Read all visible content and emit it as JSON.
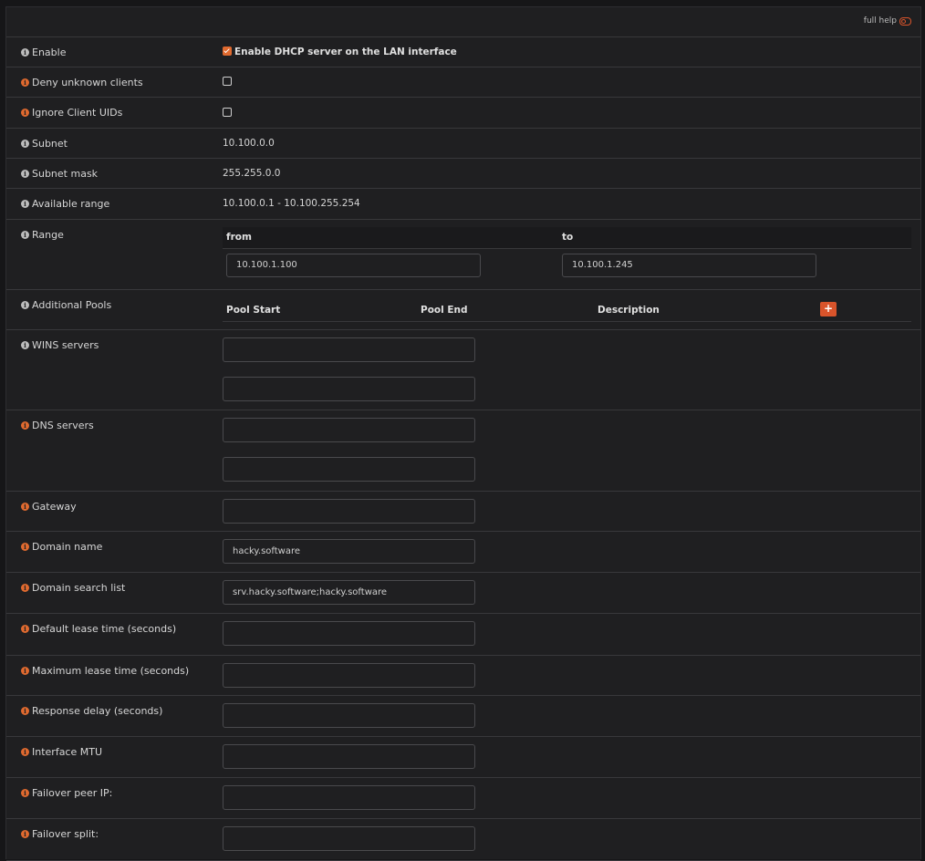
{
  "header": {
    "full_help": "full help"
  },
  "rows": {
    "enable": {
      "label": "Enable",
      "checkbox_label": "Enable DHCP server on the LAN interface",
      "checked": true
    },
    "deny_unknown": {
      "label": "Deny unknown clients",
      "checked": false
    },
    "ignore_uids": {
      "label": "Ignore Client UIDs",
      "checked": false
    },
    "subnet": {
      "label": "Subnet",
      "value": "10.100.0.0"
    },
    "subnet_mask": {
      "label": "Subnet mask",
      "value": "255.255.0.0"
    },
    "available_range": {
      "label": "Available range",
      "value": "10.100.0.1 - 10.100.255.254"
    },
    "range": {
      "label": "Range",
      "from_label": "from",
      "to_label": "to",
      "from_value": "10.100.1.100",
      "to_value": "10.100.1.245"
    },
    "pools": {
      "label": "Additional Pools",
      "col_start": "Pool Start",
      "col_end": "Pool End",
      "col_desc": "Description",
      "add": "+"
    },
    "wins": {
      "label": "WINS servers",
      "value1": "",
      "value2": ""
    },
    "dns": {
      "label": "DNS servers",
      "value1": "",
      "value2": ""
    },
    "gateway": {
      "label": "Gateway",
      "value": ""
    },
    "domain_name": {
      "label": "Domain name",
      "value": "hacky.software"
    },
    "domain_search": {
      "label": "Domain search list",
      "value": "srv.hacky.software;hacky.software"
    },
    "default_lease": {
      "label": "Default lease time (seconds)",
      "value": ""
    },
    "max_lease": {
      "label": "Maximum lease time (seconds)",
      "value": ""
    },
    "response_delay": {
      "label": "Response delay (seconds)",
      "value": ""
    },
    "mtu": {
      "label": "Interface MTU",
      "value": ""
    },
    "failover_ip": {
      "label": "Failover peer IP:",
      "value": ""
    },
    "failover_split": {
      "label": "Failover split:",
      "value": ""
    }
  },
  "colors": {
    "accent": "#e06a2f",
    "background": "#1f1f21",
    "border": "#38383b"
  },
  "icons": {
    "info": "info-circle-icon",
    "toggle": "toggle-off-icon"
  }
}
